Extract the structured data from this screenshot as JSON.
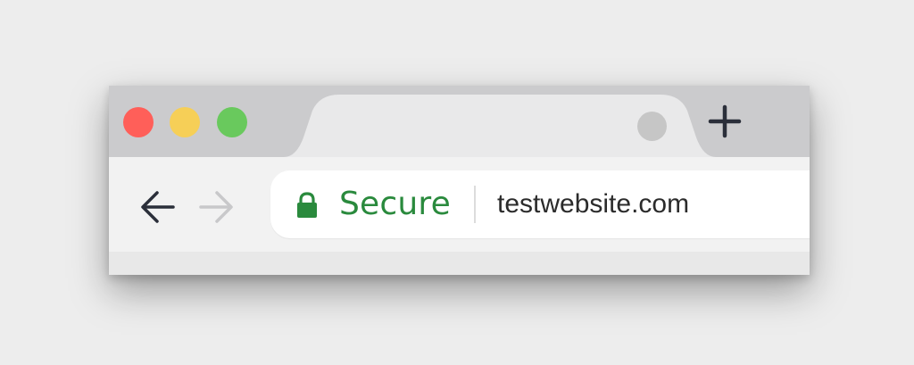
{
  "window": {
    "controls": [
      "close",
      "minimize",
      "zoom"
    ],
    "colors": {
      "close": "#ff5f59",
      "minimize": "#f6cf57",
      "zoom": "#69c95d",
      "tabstrip": "#cbcbcd",
      "active_tab": "#e9e9ea",
      "toolbar": "#f2f2f2"
    }
  },
  "tabstrip": {
    "new_tab_icon": "plus-icon",
    "tab_close_icon": "circle-icon"
  },
  "toolbar": {
    "back_icon": "arrow-left-icon",
    "forward_icon": "arrow-right-icon",
    "forward_enabled": false
  },
  "omnibox": {
    "lock_icon": "lock-icon",
    "security_label": "Secure",
    "security_color": "#2a8a3d",
    "url": "testwebsite.com"
  }
}
